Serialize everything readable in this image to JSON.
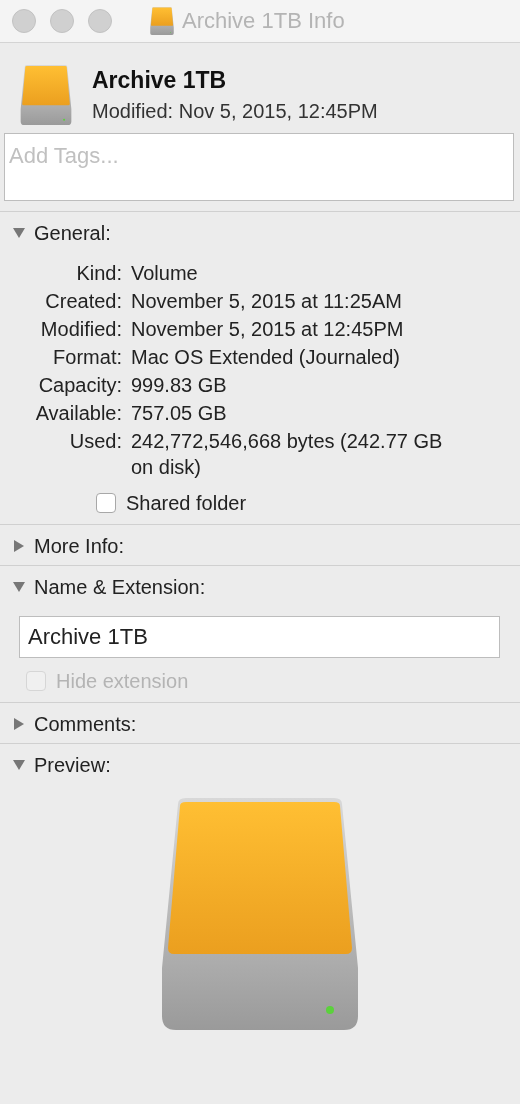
{
  "window": {
    "title": "Archive 1TB Info"
  },
  "header": {
    "name": "Archive 1TB",
    "modified": "Modified: Nov 5, 2015, 12:45PM"
  },
  "tags": {
    "placeholder": "Add Tags..."
  },
  "sections": [
    {
      "kind": "general",
      "title": "General:",
      "expanded": true,
      "rows": [
        {
          "label": "Kind:",
          "value": "Volume"
        },
        {
          "label": "Created:",
          "value": "November 5, 2015 at 11:25AM"
        },
        {
          "label": "Modified:",
          "value": "November 5, 2015 at 12:45PM"
        },
        {
          "label": "Format:",
          "value": "Mac OS Extended (Journaled)"
        },
        {
          "label": "Capacity:",
          "value": "999.83 GB"
        },
        {
          "label": "Available:",
          "value": "757.05 GB"
        },
        {
          "label": "Used:",
          "value": "242,772,546,668 bytes (242.77 GB on disk)"
        }
      ],
      "shared_folder": {
        "label": "Shared folder",
        "checked": false,
        "disabled": false
      }
    },
    {
      "title": "More Info:",
      "expanded": false
    },
    {
      "kind": "name",
      "title": "Name & Extension:",
      "expanded": true,
      "value": "Archive 1TB",
      "hide_extension": {
        "label": "Hide extension",
        "checked": false,
        "disabled": true
      }
    },
    {
      "title": "Comments:",
      "expanded": false
    },
    {
      "kind": "preview",
      "title": "Preview:",
      "expanded": true
    }
  ]
}
